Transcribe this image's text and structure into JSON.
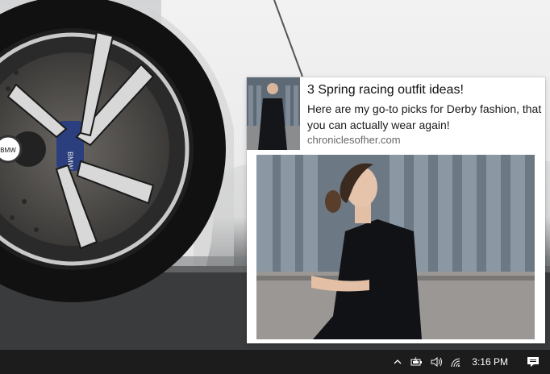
{
  "wallpaper": {
    "badge_text": "BMW",
    "brand_text": "BMW"
  },
  "notification": {
    "title": "3 Spring racing outfit ideas!",
    "body": "Here are my go-to picks for Derby fashion, that you can actually wear again!",
    "domain": "chroniclesofher.com"
  },
  "taskbar": {
    "clock": "3:16 PM",
    "icons": [
      "chevron-up-icon",
      "battery-icon",
      "volume-icon",
      "wifi-icon",
      "action-center-icon"
    ]
  }
}
